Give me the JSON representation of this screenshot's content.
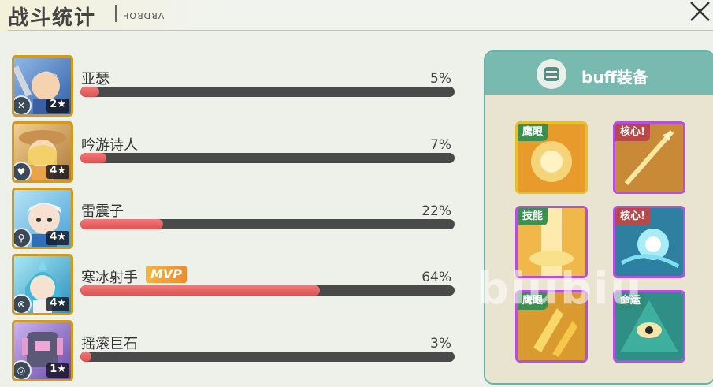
{
  "header": {
    "title": "战斗统计",
    "subtitle": "ꟻOꓤꓷꓤA",
    "close_icon": "close-icon"
  },
  "heroes": [
    {
      "name": "亚瑟",
      "stars": "2★",
      "percent_label": "5%",
      "share": 5,
      "role_icon": "sword-icon"
    },
    {
      "name": "吟游诗人",
      "stars": "4★",
      "percent_label": "7%",
      "share": 7,
      "role_icon": "heart-icon"
    },
    {
      "name": "雷震子",
      "stars": "4★",
      "percent_label": "22%",
      "share": 22,
      "role_icon": "wand-icon"
    },
    {
      "name": "寒冰射手",
      "stars": "4★",
      "percent_label": "64%",
      "share": 64,
      "role_icon": "crosshair-icon",
      "badge": "MVP"
    },
    {
      "name": "摇滚巨石",
      "stars": "1★",
      "percent_label": "3%",
      "share": 3,
      "role_icon": "target-icon"
    }
  ],
  "buff_panel": {
    "title": "buff装备",
    "icon": "armor-icon",
    "cards": [
      {
        "tag": "鹰眼",
        "frame": "gold",
        "art": "explosion"
      },
      {
        "tag": "核心!",
        "frame": "purple",
        "art": "spear"
      },
      {
        "tag": "技能",
        "frame": "purple",
        "art": "light-pillar"
      },
      {
        "tag": "核心!",
        "frame": "purple",
        "art": "orb"
      },
      {
        "tag": "鹰眼",
        "frame": "purple",
        "art": "golden-blades"
      },
      {
        "tag": "命运",
        "frame": "purple",
        "art": "eye"
      }
    ]
  },
  "watermark": "biubiu",
  "colors": {
    "bar_fill": "#e05050",
    "bar_track": "#4a4a4a",
    "panel_header": "#79bab0",
    "gold_frame": "#e4c02c",
    "purple_frame": "#b54fe0"
  }
}
